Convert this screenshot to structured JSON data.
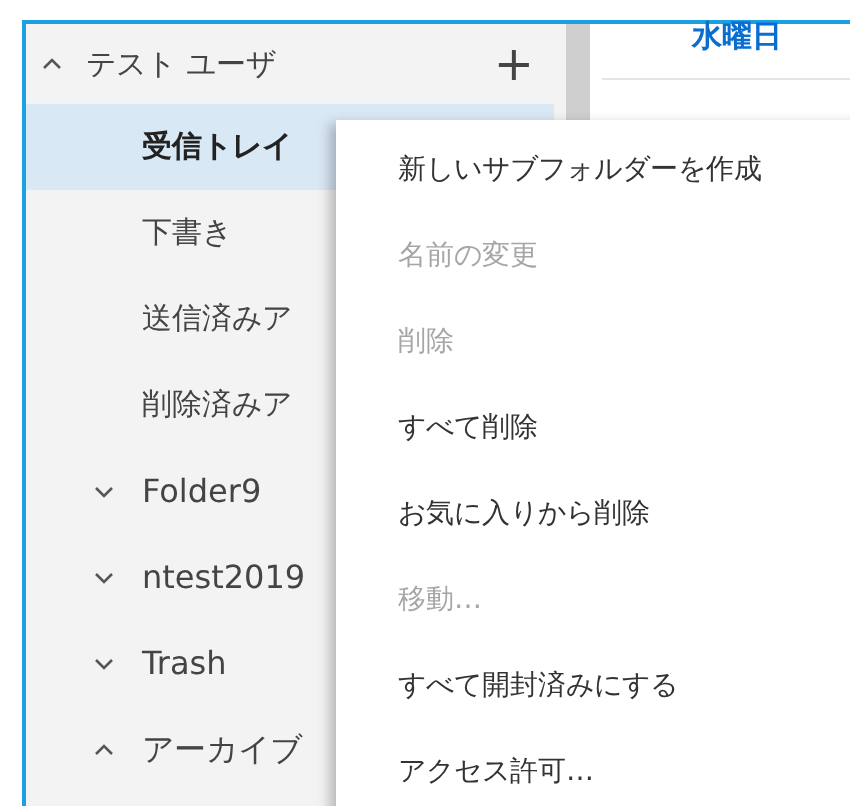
{
  "account": {
    "name": "テスト ユーザ",
    "expanded": true,
    "add_label": "+"
  },
  "folders": [
    {
      "name": "受信トレイ",
      "selected": true,
      "kind": "child"
    },
    {
      "name": "下書き",
      "selected": false,
      "kind": "child"
    },
    {
      "name": "送信済みア",
      "selected": false,
      "kind": "child"
    },
    {
      "name": "削除済みア",
      "selected": false,
      "kind": "child"
    },
    {
      "name": "Folder9",
      "selected": false,
      "kind": "group",
      "expanded": false
    },
    {
      "name": "ntest2019",
      "selected": false,
      "kind": "group",
      "expanded": false
    },
    {
      "name": "Trash",
      "selected": false,
      "kind": "group",
      "expanded": false
    },
    {
      "name": "アーカイブ",
      "selected": false,
      "kind": "group",
      "expanded": true
    }
  ],
  "message_list": {
    "day": "水曜日"
  },
  "context_menu": [
    {
      "label": "新しいサブフォルダーを作成",
      "disabled": false
    },
    {
      "label": "名前の変更",
      "disabled": true
    },
    {
      "label": "削除",
      "disabled": true
    },
    {
      "label": "すべて削除",
      "disabled": false
    },
    {
      "label": "お気に入りから削除",
      "disabled": false
    },
    {
      "label": "移動…",
      "disabled": true
    },
    {
      "label": "すべて開封済みにする",
      "disabled": false
    },
    {
      "label": "アクセス許可…",
      "disabled": false
    }
  ]
}
